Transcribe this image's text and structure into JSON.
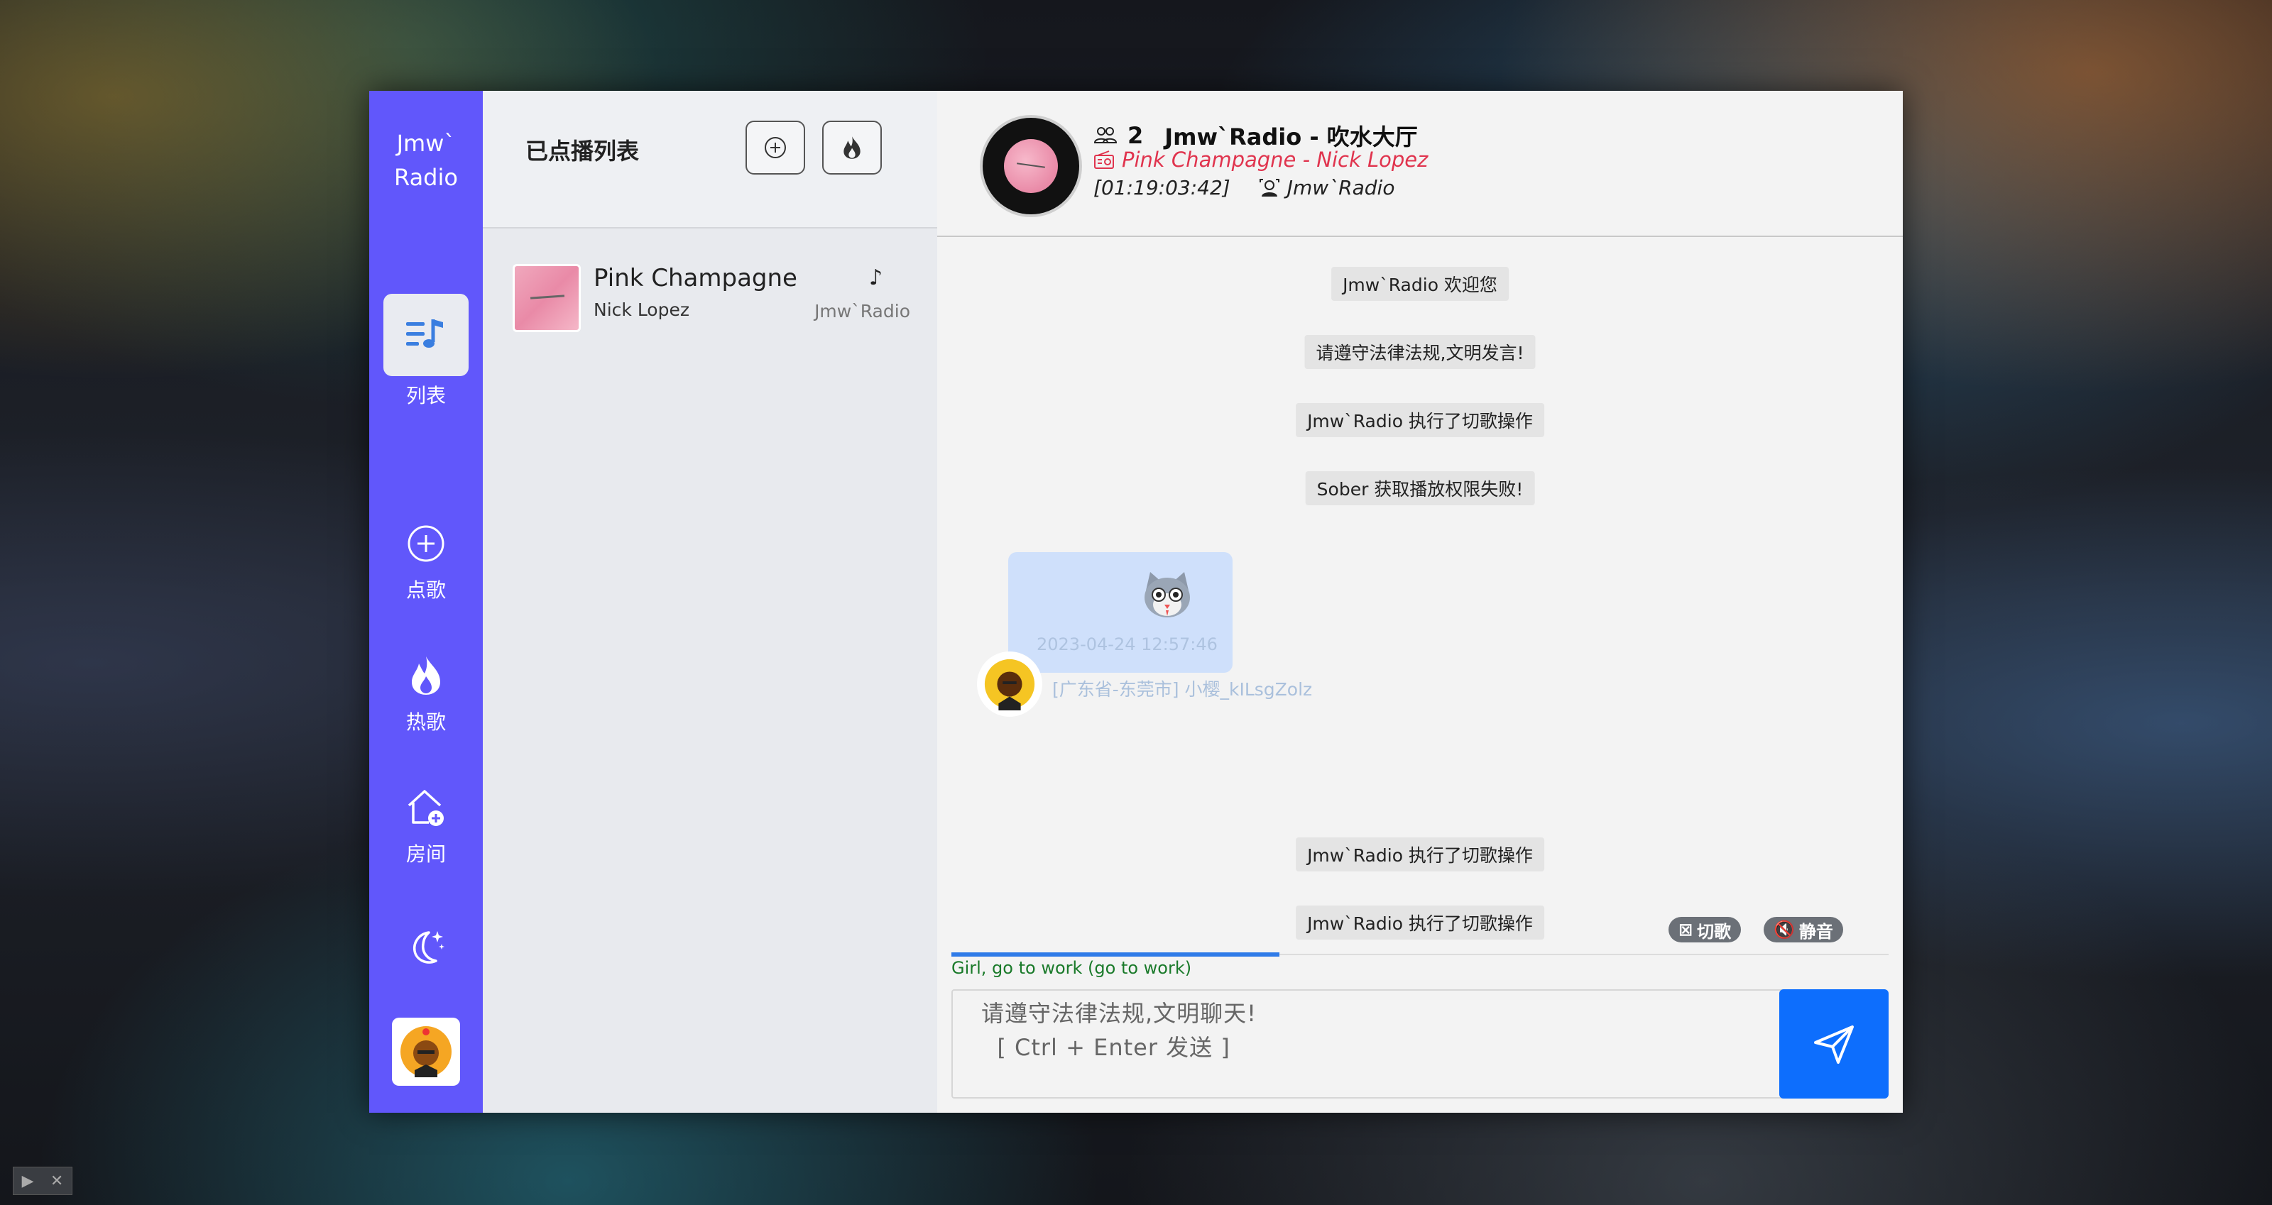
{
  "app": {
    "brand": "Jmw`\nRadio"
  },
  "sidebar": {
    "items": [
      {
        "label": "列表",
        "icon": "playlist-icon",
        "active": true
      },
      {
        "label": "点歌",
        "icon": "add-circle-icon",
        "active": false
      },
      {
        "label": "热歌",
        "icon": "fire-icon",
        "active": false
      },
      {
        "label": "房间",
        "icon": "home-add-icon",
        "active": false
      }
    ],
    "theme_icon": "moon-stars-icon",
    "avatar_icon": "user-avatar-icon"
  },
  "playlist": {
    "title": "已点播列表",
    "buttons": [
      {
        "icon": "add-circle-icon"
      },
      {
        "icon": "fire-icon"
      }
    ],
    "items": [
      {
        "song": "Pink Champagne",
        "artist": "Nick Lopez",
        "requested_by": "Jmw`Radio",
        "icon": "music-note-icon"
      }
    ]
  },
  "header": {
    "online_count": "2",
    "room_name": "Jmw`Radio - 吹水大厅",
    "now_playing": "Pink Champagne - Nick Lopez",
    "time_open": "[",
    "time_current": "01:19",
    "time_sep": " : ",
    "time_total": "03:42",
    "time_close": "]",
    "owner": "Jmw`Radio"
  },
  "messages": {
    "system": [
      "Jmw`Radio 欢迎您",
      "请遵守法律法规,文明发言!",
      "Jmw`Radio 执行了切歌操作",
      "Sober 获取播放权限失败!",
      "Jmw`Radio 执行了切歌操作",
      "Jmw`Radio 执行了切歌操作"
    ],
    "user": {
      "time": "2023-04-24 12:57:46",
      "name": "[广东省-东莞市] 小樱_kILsgZolz",
      "sticker": "cat-sticker-icon"
    }
  },
  "controls": {
    "skip_label": "切歌",
    "mute_label": "静音"
  },
  "player": {
    "progress": 0.35,
    "lyric": "Girl, go to work (go to work)"
  },
  "input": {
    "placeholder": "请遵守法律法规,文明聊天!\n  [ Ctrl + Enter 发送 ]"
  },
  "colors": {
    "sidebar": "#6157fb",
    "accent": "#0d6efd",
    "now_playing": "#e0344e",
    "lyric": "#1a7a2a"
  }
}
